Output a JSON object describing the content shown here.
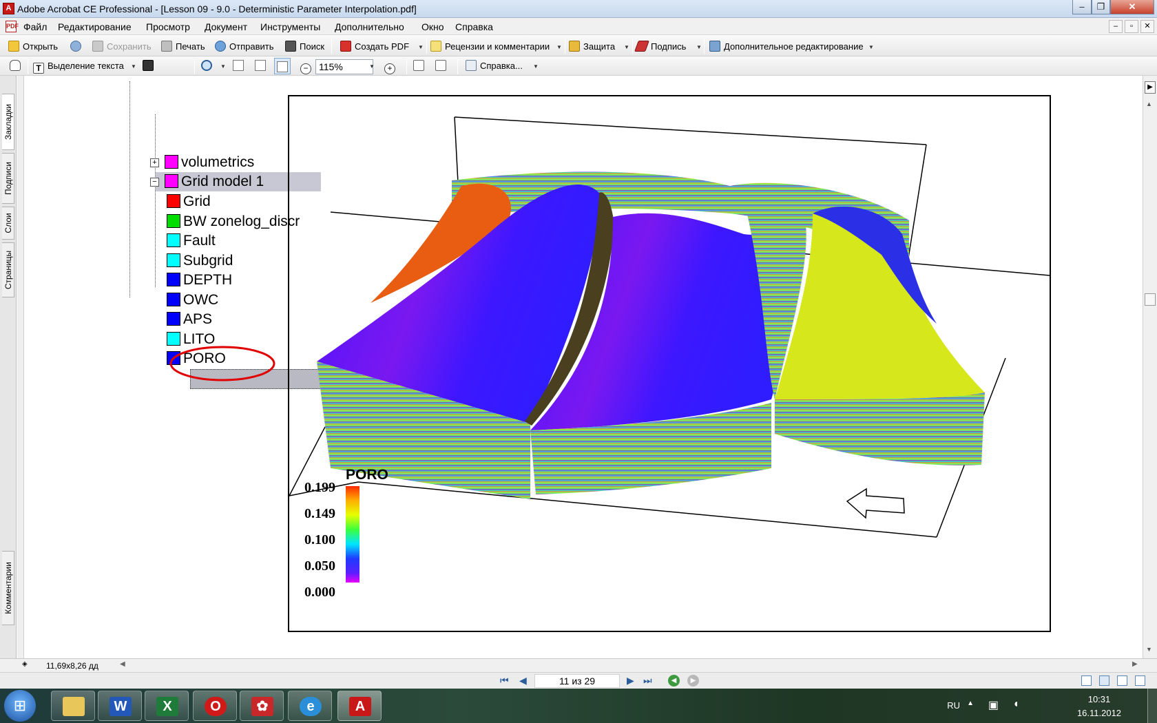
{
  "window": {
    "title": "Adobe Acrobat CE Professional - [Lesson 09 - 9.0 - Deterministic Parameter Interpolation.pdf]",
    "controls": {
      "minimize": "–",
      "maximize": "❐",
      "close": "✕"
    }
  },
  "menu": {
    "items": [
      "Файл",
      "Редактирование",
      "Просмотр",
      "Документ",
      "Инструменты",
      "Дополнительно",
      "Окно",
      "Справка"
    ],
    "doc_controls": {
      "minimize": "–",
      "restore": "▫",
      "close": "✕"
    }
  },
  "toolbar1": {
    "open": "Открыть",
    "save": "Сохранить",
    "print": "Печать",
    "send": "Отправить",
    "search": "Поиск",
    "create_pdf": "Создать PDF",
    "review": "Рецензии и комментарии",
    "secure": "Защита",
    "sign": "Подпись",
    "advanced_edit": "Дополнительное редактирование"
  },
  "toolbar2": {
    "select_text": "Выделение текста",
    "zoom": "115%",
    "help": "Справка..."
  },
  "side_tabs": [
    "Закладки",
    "Подписи",
    "Слои",
    "Страницы",
    "Комментарии"
  ],
  "page": {
    "tree": {
      "items": [
        {
          "label": "volumetrics",
          "color": "#ff00ff",
          "expander": "+"
        },
        {
          "label": "Grid model 1",
          "color": "#ff00ff",
          "expander": "−"
        },
        {
          "label": "Grid",
          "color": "#ff0000"
        },
        {
          "label": "BW zonelog_discr",
          "color": "#00dd00"
        },
        {
          "label": "Fault",
          "color": "#00ffff"
        },
        {
          "label": "Subgrid",
          "color": "#00ffff"
        },
        {
          "label": "DEPTH",
          "color": "#0000ff"
        },
        {
          "label": "OWC",
          "color": "#0000ff"
        },
        {
          "label": "APS",
          "color": "#0000ff"
        },
        {
          "label": "LITO",
          "color": "#00ffff"
        },
        {
          "label": "PORO",
          "color": "#0000ff"
        }
      ]
    },
    "legend": {
      "title": "PORO",
      "ticks": [
        "0.199",
        "0.149",
        "0.100",
        "0.050",
        "0.000"
      ]
    }
  },
  "status": {
    "page_size": "11,69x8,26 дд"
  },
  "nav": {
    "page_indicator": "11 из 29"
  },
  "taskbar": {
    "start": "⊞",
    "apps": [
      "explorer",
      "word",
      "excel",
      "opera",
      "app-red",
      "internet-explorer",
      "acrobat"
    ],
    "lang": "RU",
    "time": "10:31",
    "date": "16.11.2012"
  }
}
